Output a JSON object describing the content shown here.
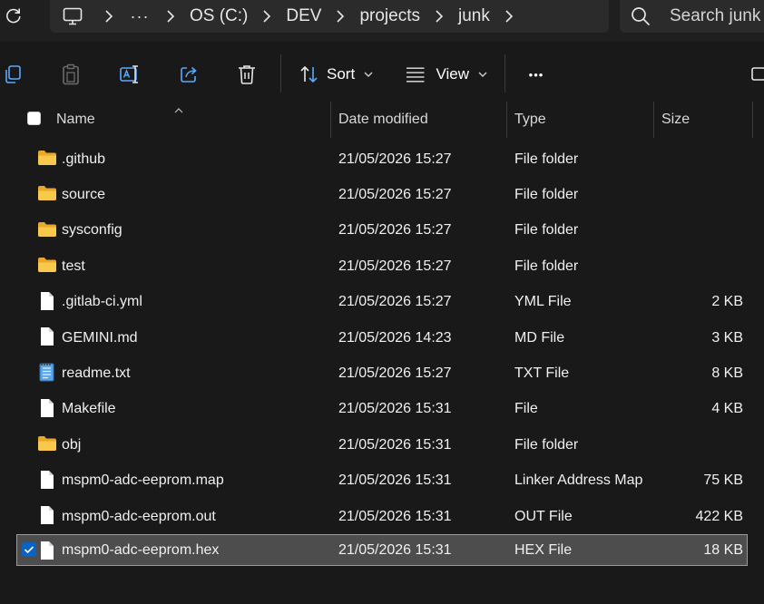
{
  "address": {
    "more_label": "···",
    "crumbs": [
      "OS (C:)",
      "DEV",
      "projects",
      "junk"
    ]
  },
  "search": {
    "placeholder": "Search junk"
  },
  "toolbar": {
    "sort_label": "Sort",
    "view_label": "View",
    "more_label": "•••"
  },
  "columns": {
    "name": "Name",
    "date": "Date modified",
    "type": "Type",
    "size": "Size"
  },
  "files": [
    {
      "name": ".github",
      "date": "21/05/2026 15:27",
      "type": "File folder",
      "size": "",
      "icon": "folder-icon"
    },
    {
      "name": "source",
      "date": "21/05/2026 15:27",
      "type": "File folder",
      "size": "",
      "icon": "folder-icon"
    },
    {
      "name": "sysconfig",
      "date": "21/05/2026 15:27",
      "type": "File folder",
      "size": "",
      "icon": "folder-icon"
    },
    {
      "name": "test",
      "date": "21/05/2026 15:27",
      "type": "File folder",
      "size": "",
      "icon": "folder-icon"
    },
    {
      "name": ".gitlab-ci.yml",
      "date": "21/05/2026 15:27",
      "type": "YML File",
      "size": "2 KB",
      "icon": "file-icon"
    },
    {
      "name": "GEMINI.md",
      "date": "21/05/2026 14:23",
      "type": "MD File",
      "size": "3 KB",
      "icon": "file-icon"
    },
    {
      "name": "readme.txt",
      "date": "21/05/2026 15:27",
      "type": "TXT File",
      "size": "8 KB",
      "icon": "notepad-icon"
    },
    {
      "name": "Makefile",
      "date": "21/05/2026 15:31",
      "type": "File",
      "size": "4 KB",
      "icon": "file-icon"
    },
    {
      "name": "obj",
      "date": "21/05/2026 15:31",
      "type": "File folder",
      "size": "",
      "icon": "folder-icon"
    },
    {
      "name": "mspm0-adc-eeprom.map",
      "date": "21/05/2026 15:31",
      "type": "Linker Address Map",
      "size": "75 KB",
      "icon": "file-icon"
    },
    {
      "name": "mspm0-adc-eeprom.out",
      "date": "21/05/2026 15:31",
      "type": "OUT File",
      "size": "422 KB",
      "icon": "file-icon"
    },
    {
      "name": "mspm0-adc-eeprom.hex",
      "date": "21/05/2026 15:31",
      "type": "HEX File",
      "size": "18 KB",
      "icon": "file-icon",
      "selected": true
    }
  ],
  "colors": {
    "background": "#191919",
    "folder": "#f5c03b",
    "selection": "#4d4d4d",
    "accent": "#0a63c2"
  }
}
